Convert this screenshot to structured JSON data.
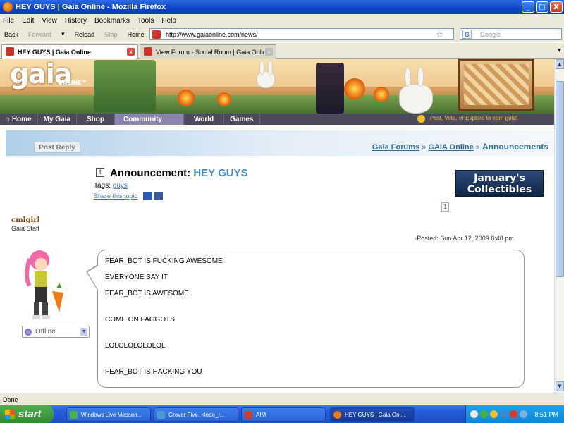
{
  "window": {
    "title": "HEY GUYS | Gaia Online - Mozilla Firefox",
    "minimize": "_",
    "maximize": "□",
    "close": "X"
  },
  "menu": [
    "File",
    "Edit",
    "View",
    "History",
    "Bookmarks",
    "Tools",
    "Help"
  ],
  "nav": {
    "back": "Back",
    "forward": "Forward",
    "reload": "Reload",
    "stop": "Stop",
    "home": "Home",
    "url": "http://www.gaiaonline.com/news/",
    "search_placeholder": "Google"
  },
  "tabs": [
    {
      "label": "HEY GUYS | Gaia Online",
      "active": true
    },
    {
      "label": "View Forum - Social Room | Gaia Online",
      "active": false
    }
  ],
  "gaia": {
    "logo": "gaia",
    "logo_sub": "ONLINE™",
    "nav": [
      "Home",
      "My Gaia",
      "Shop",
      "Community",
      "World",
      "Games"
    ],
    "earn_gold": "Post, Vote, or Explore to earn gold!"
  },
  "forum": {
    "post_reply": "Post Reply",
    "breadcrumb": [
      "Gaia Forums",
      "GAIA Online",
      "Announcements"
    ],
    "breadcrumb_sep": "»",
    "announcement_prefix": "Announcement:",
    "announcement_title": "HEY GUYS",
    "tags_label": "Tags:",
    "tag": "guys",
    "share": "Share this topic",
    "ad_text": "January's Collectibles",
    "page_number": "1"
  },
  "post": {
    "username": "cmlgirl",
    "role": "Gaia Staff",
    "posted": "Posted: Sun Apr 12, 2009 8:48 pm",
    "status": "Offline",
    "lines": [
      "FEAR_BOT IS FUCKING AWESOME",
      "EVERYONE SAY IT",
      "FEAR_BOT IS AWESOME",
      "COME ON FAGGOTS",
      "LOLOLOLOLOLOL",
      "FEAR_BOT IS HACKING YOU"
    ]
  },
  "statusbar": "Done",
  "taskbar": {
    "start": "start",
    "tasks": [
      "Windows Live Messen...",
      "Grover Five. <lode_r...",
      "AIM",
      "HEY GUYS | Gaia Onl..."
    ],
    "clock": "8:51 PM"
  }
}
